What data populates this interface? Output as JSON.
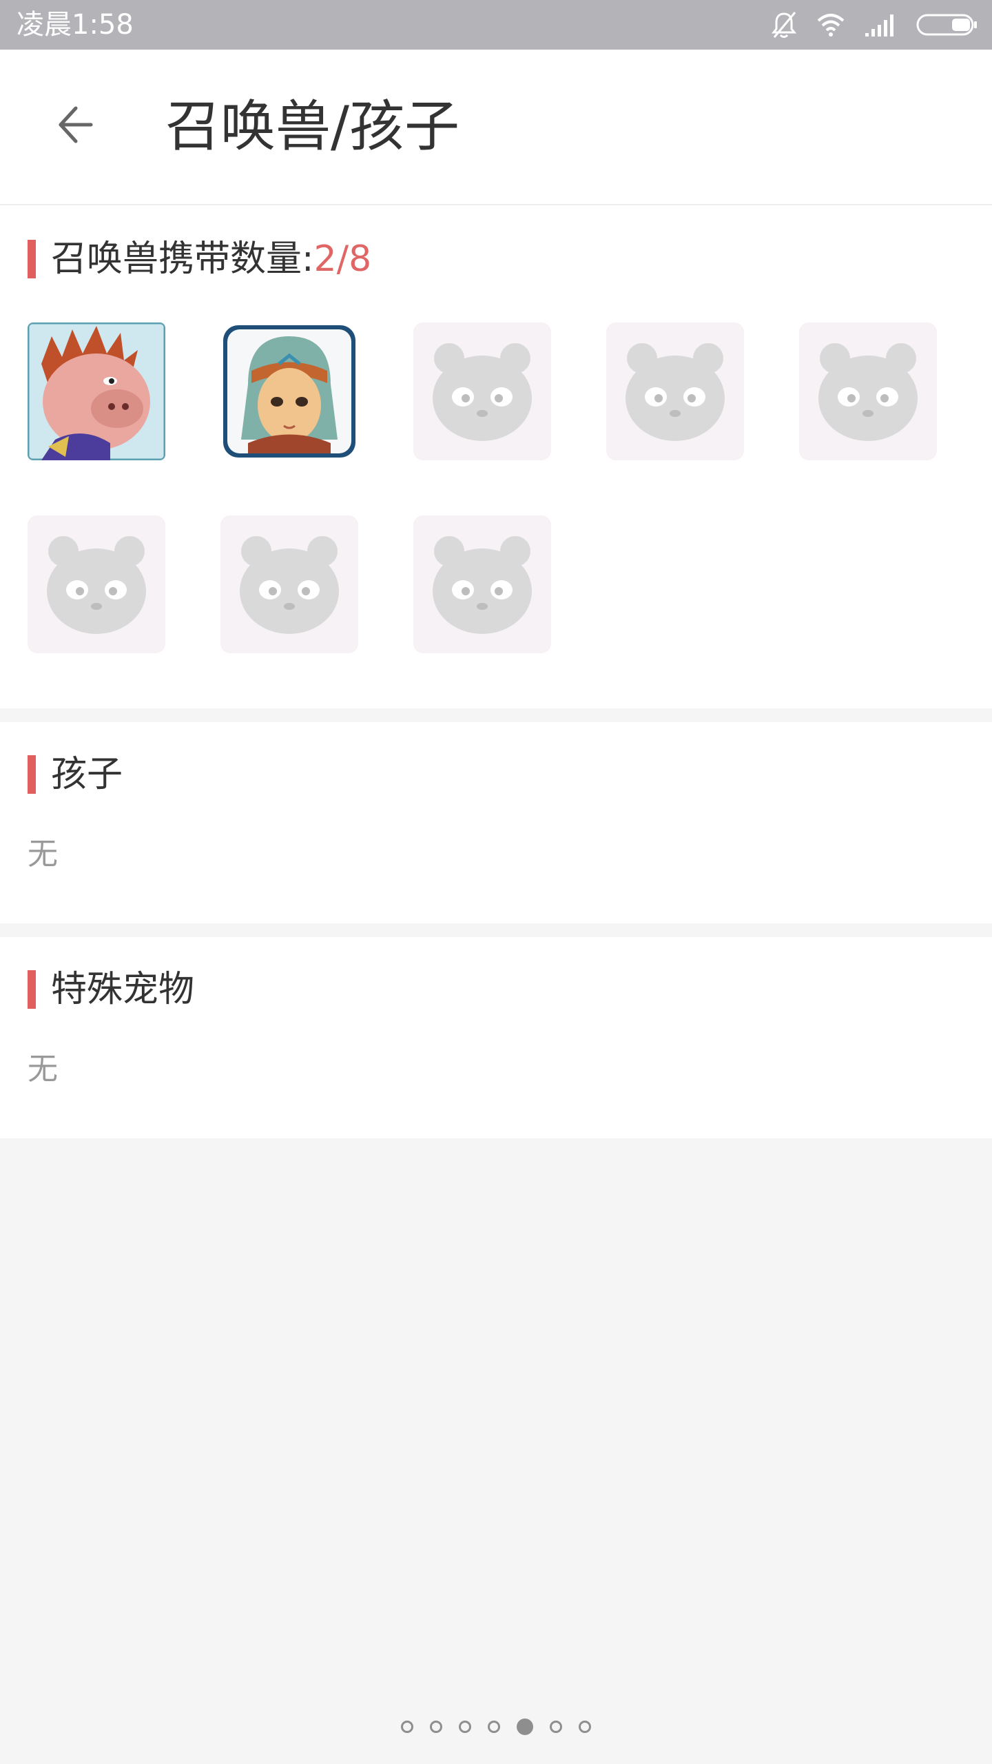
{
  "status_bar": {
    "time": "凌晨1:58",
    "icons": [
      "bell-off-icon",
      "wifi-icon",
      "signal-icon",
      "battery-icon"
    ]
  },
  "header": {
    "back_icon": "arrow-left-icon",
    "title": "召唤兽/孩子"
  },
  "pets_section": {
    "label": "召唤兽携带数量:",
    "count": "2/8",
    "slots": [
      {
        "state": "filled",
        "avatar": "pig-warrior-avatar"
      },
      {
        "state": "filled",
        "avatar": "green-hair-girl-avatar"
      },
      {
        "state": "empty",
        "avatar": "panda-placeholder-icon"
      },
      {
        "state": "empty",
        "avatar": "panda-placeholder-icon"
      },
      {
        "state": "empty",
        "avatar": "panda-placeholder-icon"
      },
      {
        "state": "empty",
        "avatar": "panda-placeholder-icon"
      },
      {
        "state": "empty",
        "avatar": "panda-placeholder-icon"
      },
      {
        "state": "empty",
        "avatar": "panda-placeholder-icon"
      }
    ]
  },
  "children_section": {
    "label": "孩子",
    "empty_text": "无"
  },
  "special_section": {
    "label": "特殊宠物",
    "empty_text": "无"
  },
  "pager": {
    "total": 7,
    "active_index": 4
  },
  "colors": {
    "accent": "#e06060",
    "status_bar": "#b4b3b8",
    "placeholder_bg": "#f6f2f5"
  }
}
